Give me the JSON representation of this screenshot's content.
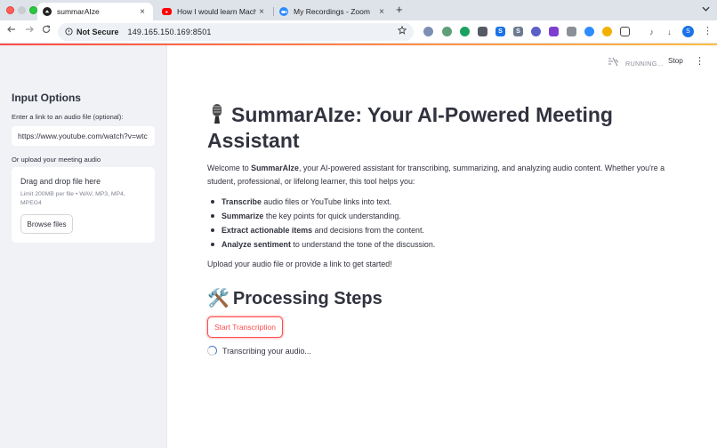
{
  "browser": {
    "tabs": [
      {
        "title": "summarAIze",
        "fav_color": "#1f1f1f"
      },
      {
        "title": "How I would learn Machine Le",
        "fav_color": "#ff0000"
      },
      {
        "title": "My Recordings - Zoom",
        "fav_color": "#2d8cff"
      }
    ],
    "close_glyph": "×",
    "new_tab_glyph": "+",
    "address": {
      "security_label": "Not Secure",
      "url": "149.165.150.169:8501"
    },
    "profile_initial": "S"
  },
  "app": {
    "status": {
      "running_label": "RUNNING...",
      "stop_label": "Stop"
    },
    "sidebar": {
      "title": "Input Options",
      "link_label": "Enter a link to an audio file (optional):",
      "link_value": "https://www.youtube.com/watch?v=wtc",
      "upload_label": "Or upload your meeting audio",
      "dropzone_title": "Drag and drop file here",
      "dropzone_limit": "Limit 200MB per file • WAV, MP3, MP4, MPEG4",
      "browse_label": "Browse files"
    },
    "main": {
      "title": "SummarAIze: Your AI-Powered Meeting Assistant",
      "intro_prefix": "Welcome to ",
      "intro_brand": "SummarAIze",
      "intro_suffix": ", your AI-powered assistant for transcribing, summarizing, and analyzing audio content. Whether you're a student, professional, or lifelong learner, this tool helps you:",
      "bullets": [
        {
          "bold": "Transcribe",
          "rest": " audio files or YouTube links into text."
        },
        {
          "bold": "Summarize",
          "rest": " the key points for quick understanding."
        },
        {
          "bold": "Extract actionable items",
          "rest": " and decisions from the content."
        },
        {
          "bold": "Analyze sentiment",
          "rest": " to understand the tone of the discussion."
        }
      ],
      "upload_prompt": "Upload your audio file or provide a link to get started!",
      "steps_heading_icon": "🛠️",
      "steps_heading": "Processing Steps",
      "start_button": "Start Transcription",
      "spinner_text": "Transcribing your audio..."
    }
  }
}
